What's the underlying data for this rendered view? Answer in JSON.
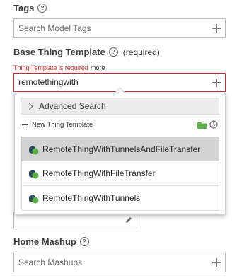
{
  "tags": {
    "label": "Tags",
    "help_symbol": "?",
    "placeholder": "Search Model Tags"
  },
  "base_template": {
    "label": "Base Thing Template",
    "help_symbol": "?",
    "required_text": "(required)",
    "error_text": "Thing Template is required",
    "more_link": "more",
    "input_value": "remotethingwith"
  },
  "dropdown": {
    "advanced_search": "Advanced Search",
    "new_template": "New Thing Template",
    "options": [
      {
        "label": "RemoteThingWithTunnelsAndFileTransfer",
        "selected": true
      },
      {
        "label": "RemoteThingWithFileTransfer",
        "selected": false
      },
      {
        "label": "RemoteThingWithTunnels",
        "selected": false
      }
    ]
  },
  "home_mashup": {
    "label": "Home Mashup",
    "help_symbol": "?",
    "placeholder": "Search Mashups"
  },
  "colors": {
    "error": "#c9292b",
    "selected_row": "#d3d3d3",
    "folder_green": "#5ab047",
    "icon_dark": "#2f4f5e"
  }
}
